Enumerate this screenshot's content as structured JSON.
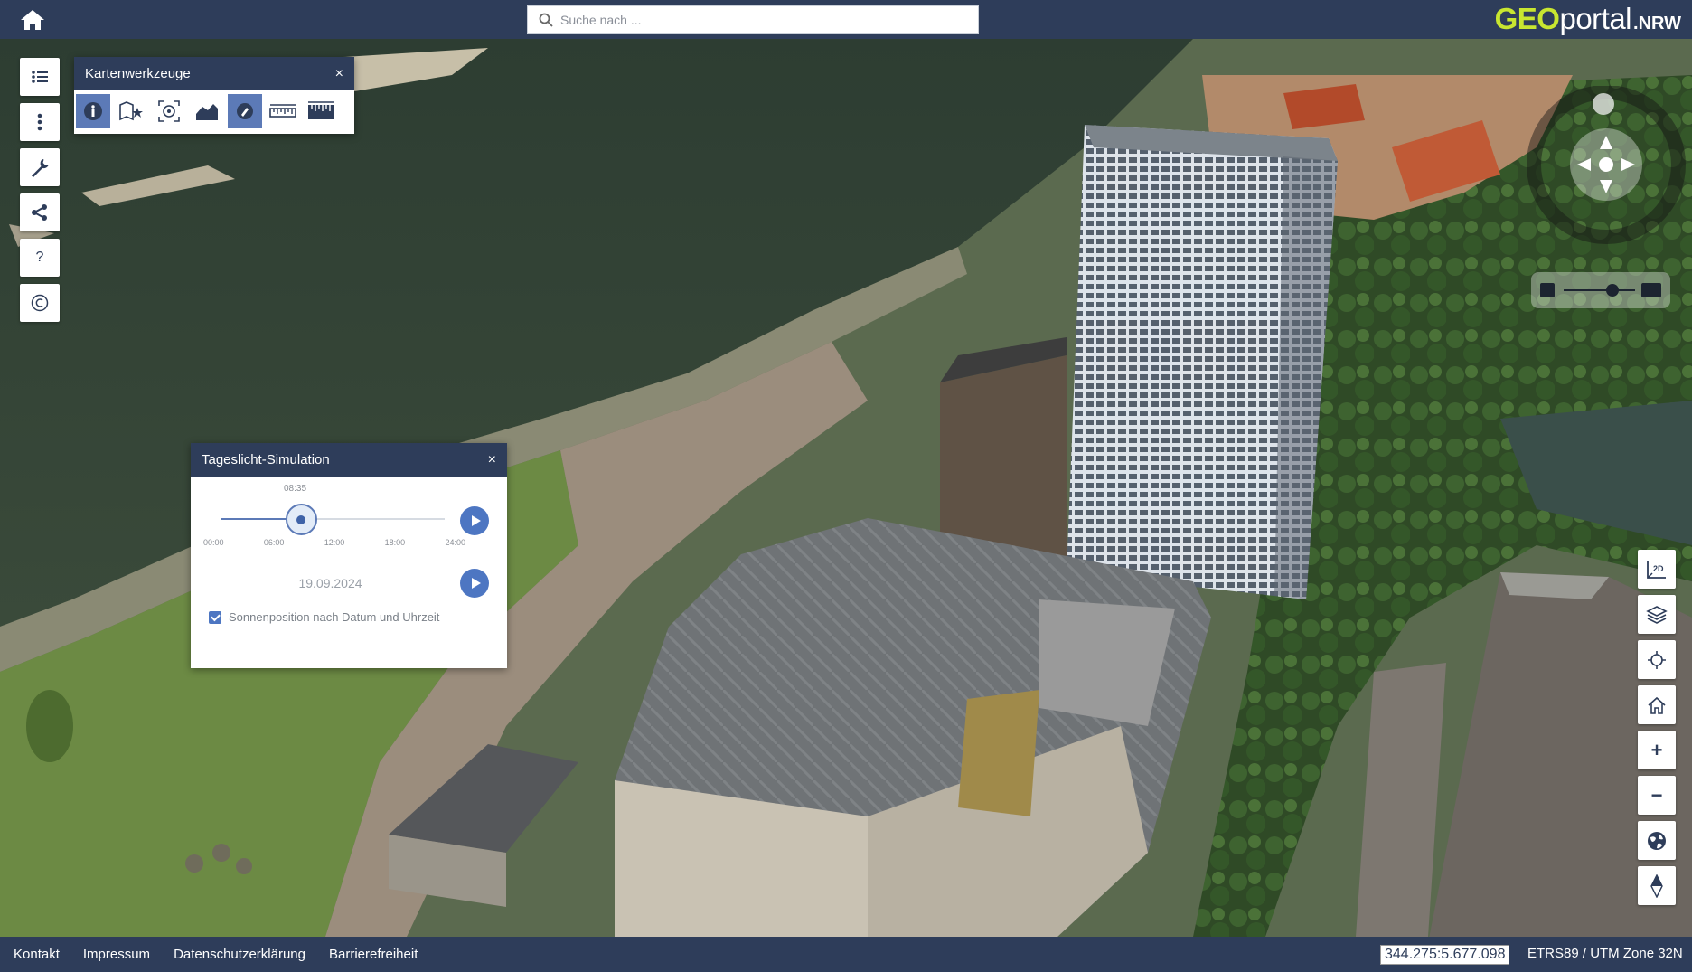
{
  "header": {
    "search_placeholder": "Suche nach ...",
    "logo_geo": "GEO",
    "logo_portal": "portal",
    "logo_nrw": ".NRW"
  },
  "left_toolbar": {
    "items": [
      "layer-tree",
      "more-menu",
      "tools",
      "share",
      "help",
      "copyright"
    ],
    "help_symbol": "?"
  },
  "kartenwerkzeuge": {
    "title": "Kartenwerkzeuge",
    "close": "×",
    "tools": [
      "info-icon",
      "map-star-icon",
      "3d-scan-icon",
      "terrain-profile-icon",
      "daylight-icon",
      "measure-distance-icon",
      "measure-height-icon"
    ],
    "active_tool": "daylight-icon"
  },
  "tageslicht": {
    "title": "Tageslicht-Simulation",
    "close": "×",
    "time": "08:35",
    "slider_fraction": 0.36,
    "tick_labels": [
      "00:00",
      "06:00",
      "12:00",
      "18:00",
      "24:00"
    ],
    "date": "19.09.2024",
    "checkbox_checked": true,
    "checkbox_label": "Sonnenposition nach Datum und Uhrzeit"
  },
  "right_toolbar": {
    "items": [
      "2d-toggle",
      "layers",
      "locate",
      "home",
      "zoom-in",
      "zoom-out",
      "globe",
      "north"
    ],
    "toggle_2d": "2D",
    "zoom_in": "+",
    "zoom_out": "−"
  },
  "footer": {
    "links": [
      "Kontakt",
      "Impressum",
      "Datenschutzerklärung",
      "Barrierefreiheit"
    ],
    "coordinates": "344.275:5.677.098",
    "crs": "ETRS89 / UTM Zone 32N"
  },
  "colors": {
    "brand_navy": "#2e3d5a",
    "logo_green": "#c8e630",
    "accent_blue": "#4d76c2"
  }
}
